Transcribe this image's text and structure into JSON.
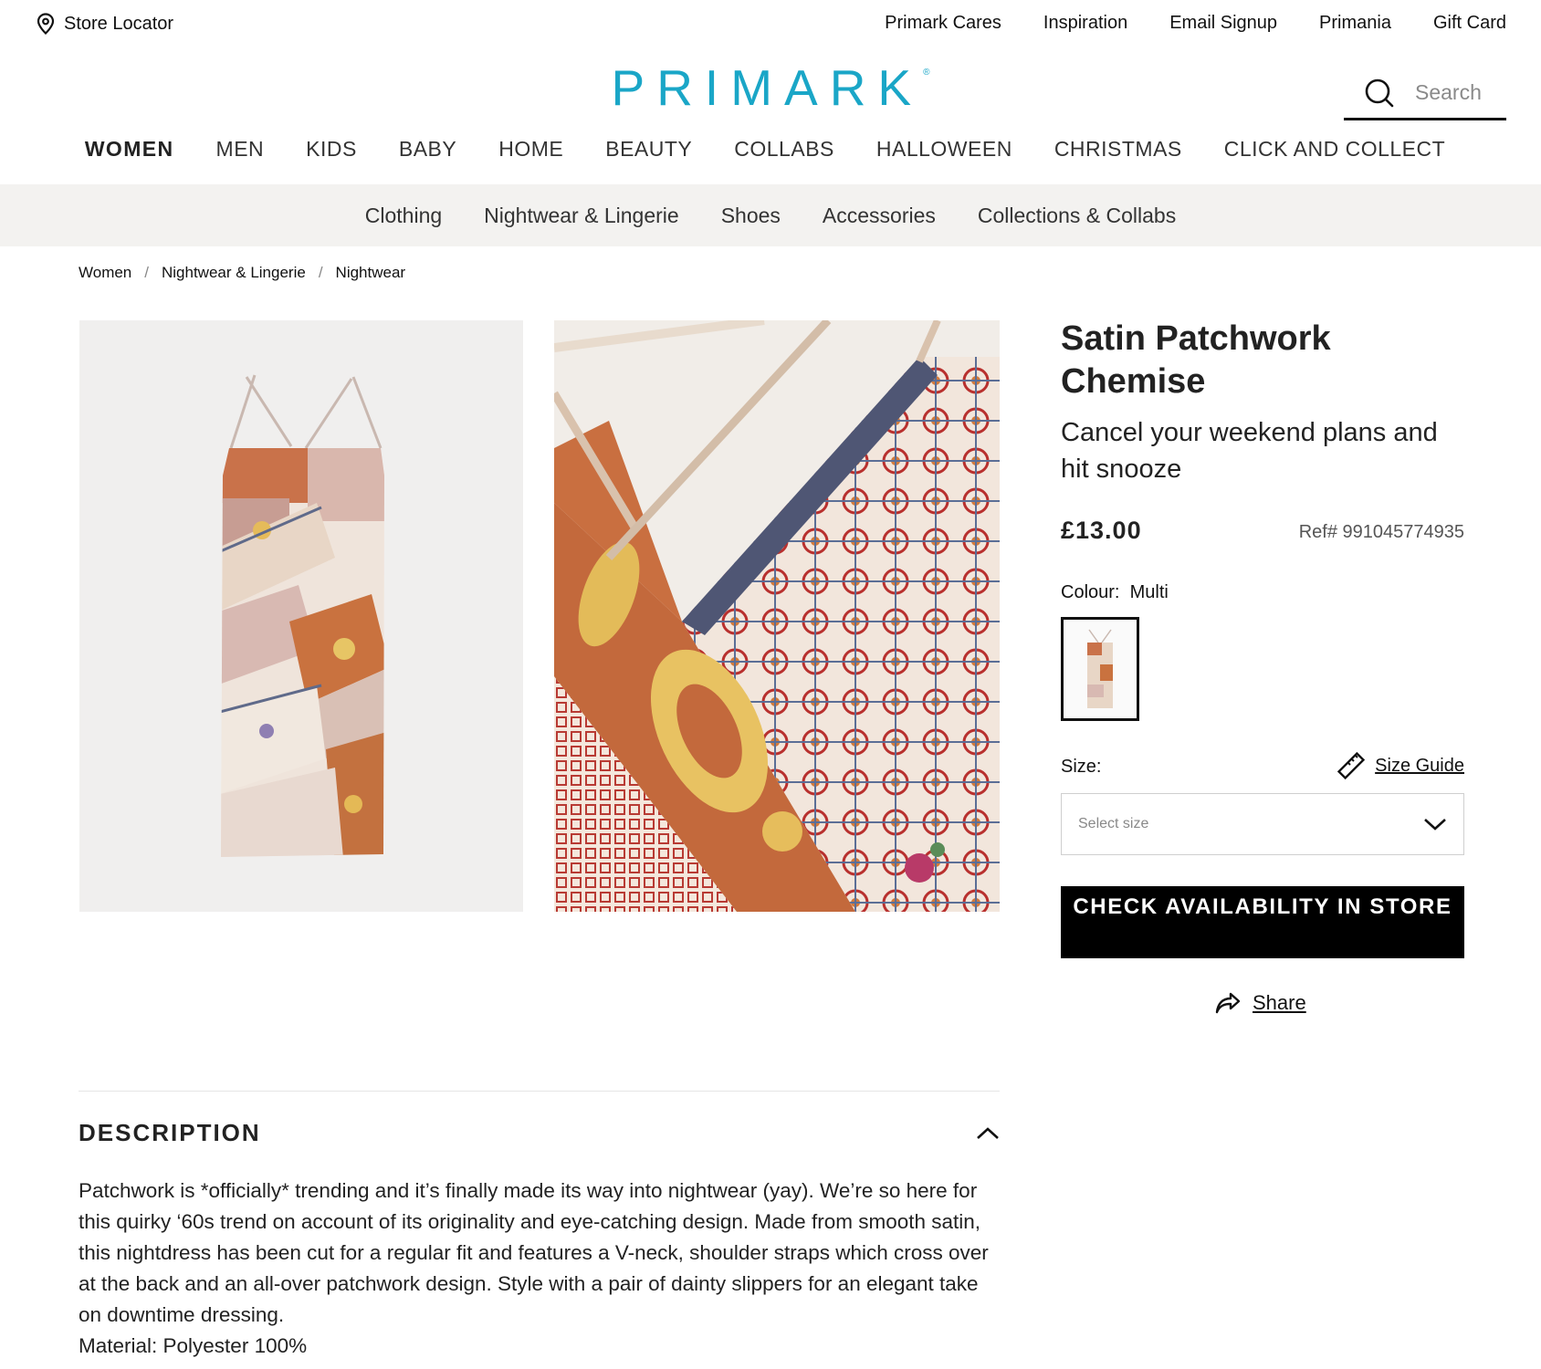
{
  "utility": {
    "store_locator": "Store Locator",
    "links": [
      "Primark Cares",
      "Inspiration",
      "Email Signup",
      "Primania",
      "Gift Card"
    ]
  },
  "brand": {
    "logo": "PRIMARK",
    "accent_color": "#1aa6c7"
  },
  "search": {
    "placeholder": "Search",
    "icon": "search-icon"
  },
  "main_nav": {
    "items": [
      "WOMEN",
      "MEN",
      "KIDS",
      "BABY",
      "HOME",
      "BEAUTY",
      "COLLABS",
      "HALLOWEEN",
      "CHRISTMAS",
      "CLICK AND COLLECT"
    ],
    "active": "WOMEN"
  },
  "sub_nav": {
    "items": [
      "Clothing",
      "Nightwear & Lingerie",
      "Shoes",
      "Accessories",
      "Collections & Collabs"
    ]
  },
  "breadcrumb": {
    "items": [
      "Women",
      "Nightwear & Lingerie",
      "Nightwear"
    ],
    "separator": "/"
  },
  "product": {
    "title": "Satin Patchwork Chemise",
    "subtitle": "Cancel your weekend plans and hit snooze",
    "price": "£13.00",
    "ref": "Ref# 991045774935",
    "colour_label": "Colour:",
    "colour_value": "Multi",
    "size_label": "Size:",
    "size_guide": "Size Guide",
    "size_placeholder": "Select size",
    "cta": "CHECK AVAILABILITY IN STORE",
    "share": "Share"
  },
  "description": {
    "heading": "DESCRIPTION",
    "body": "Patchwork is *officially* trending and it’s finally made its way into nightwear (yay). We’re so here for this quirky ‘60s trend on account of its originality and eye-catching design. Made from smooth satin, this nightdress has been cut for a regular fit and features a V-neck, shoulder straps which cross over at the back and an all-over patchwork design. Style with a pair of dainty slippers for an elegant take on downtime dressing.",
    "material": "Material: Polyester 100%"
  }
}
